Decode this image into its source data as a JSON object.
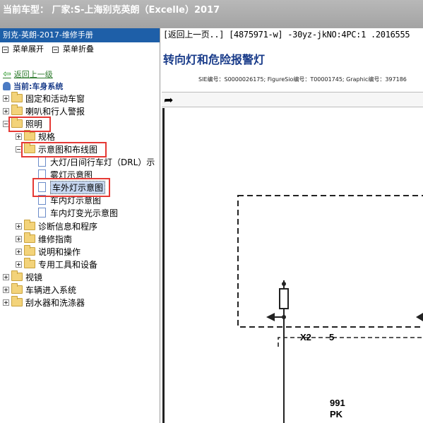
{
  "window": {
    "title": "当前车型： 厂家:S-上海别克英朗（Excelle）2017"
  },
  "sidebar": {
    "header": "别克-英朗-2017-维修手册",
    "expand_all": "菜单展开",
    "collapse_all": "菜单折叠",
    "back_link": "返回上一级",
    "current_system": "当前:车身系统",
    "tree": [
      {
        "label": "固定和活动车窗",
        "level": 0,
        "expander": "plus",
        "icon": "folder"
      },
      {
        "label": "喇叭和行人警报",
        "level": 0,
        "expander": "plus",
        "icon": "folder"
      },
      {
        "label": "照明",
        "level": 0,
        "expander": "minus",
        "icon": "folder-open",
        "highlighted": true
      },
      {
        "label": "规格",
        "level": 1,
        "expander": "plus",
        "icon": "folder"
      },
      {
        "label": "示意图和布线图",
        "level": 1,
        "expander": "minus",
        "icon": "folder-open",
        "highlighted": true
      },
      {
        "label": "大灯/日间行车灯（DRL）示",
        "level": 2,
        "icon": "document"
      },
      {
        "label": "雾灯示意图",
        "level": 2,
        "icon": "document"
      },
      {
        "label": "车外灯示意图",
        "level": 2,
        "icon": "document",
        "selected": true,
        "highlighted": true
      },
      {
        "label": "车内灯示意图",
        "level": 2,
        "icon": "document"
      },
      {
        "label": "车内灯变光示意图",
        "level": 2,
        "icon": "document"
      },
      {
        "label": "诊断信息和程序",
        "level": 1,
        "expander": "plus",
        "icon": "folder"
      },
      {
        "label": "维修指南",
        "level": 1,
        "expander": "plus",
        "icon": "folder"
      },
      {
        "label": "说明和操作",
        "level": 1,
        "expander": "plus",
        "icon": "folder"
      },
      {
        "label": "专用工具和设备",
        "level": 1,
        "expander": "plus",
        "icon": "folder"
      },
      {
        "label": "视镜",
        "level": 0,
        "expander": "plus",
        "icon": "folder"
      },
      {
        "label": "车辆进入系统",
        "level": 0,
        "expander": "plus",
        "icon": "folder"
      },
      {
        "label": "刮水器和洗涤器",
        "level": 0,
        "expander": "plus",
        "icon": "folder"
      }
    ]
  },
  "content": {
    "path": "[返回上一页..] [4875971-w] -30yz-jkNO:4PC:1 .2016555",
    "title": "转向灯和危险报警灯",
    "sie_info": "SIE编号：S0000026175;  FigureSio编号：T00001745;  Graphic编号：397186",
    "toolbar_icon": "forward-arrow-icon",
    "diagram": {
      "connector": "X2",
      "pin": "5",
      "circuit": "991",
      "wire_color": "PK"
    }
  },
  "colors": {
    "accent": "#1e5fa8",
    "highlight": "#e53935",
    "title": "#1a3c8a"
  }
}
